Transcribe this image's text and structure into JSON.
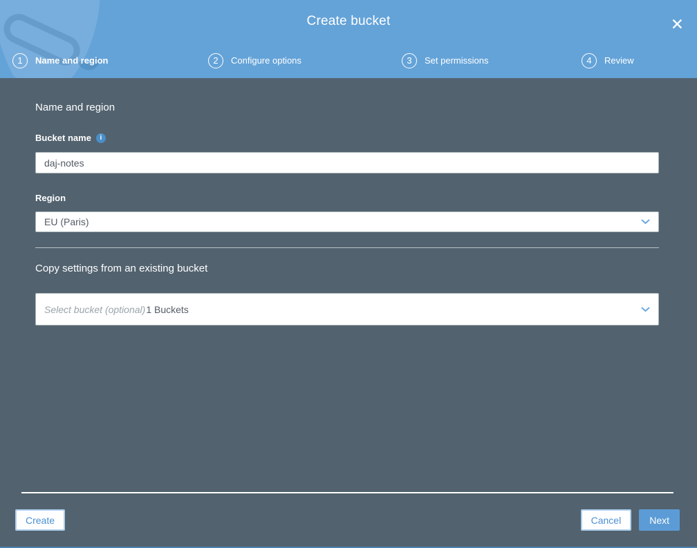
{
  "colors": {
    "header_blue": "#64a3d8",
    "body_slate": "#52626f",
    "accent_blue": "#4a90d2",
    "next_button_blue": "#5b9cd6",
    "info_icon_blue": "#4a8fc7"
  },
  "header": {
    "title": "Create bucket",
    "close_glyph": "✕",
    "steps": [
      {
        "number": "1",
        "label": "Name and region"
      },
      {
        "number": "2",
        "label": "Configure options"
      },
      {
        "number": "3",
        "label": "Set permissions"
      },
      {
        "number": "4",
        "label": "Review"
      }
    ],
    "active_step": "1"
  },
  "form": {
    "section1_heading": "Name and region",
    "bucket_name_label": "Bucket name",
    "info_glyph": "i",
    "bucket_name_value": "daj-notes",
    "region_label": "Region",
    "region_value": "EU (Paris)",
    "section2_heading": "Copy settings from an existing bucket",
    "copy_bucket_placeholder": "Select bucket (optional)",
    "copy_bucket_count": "1 Buckets"
  },
  "footer": {
    "create_label": "Create",
    "cancel_label": "Cancel",
    "next_label": "Next"
  }
}
